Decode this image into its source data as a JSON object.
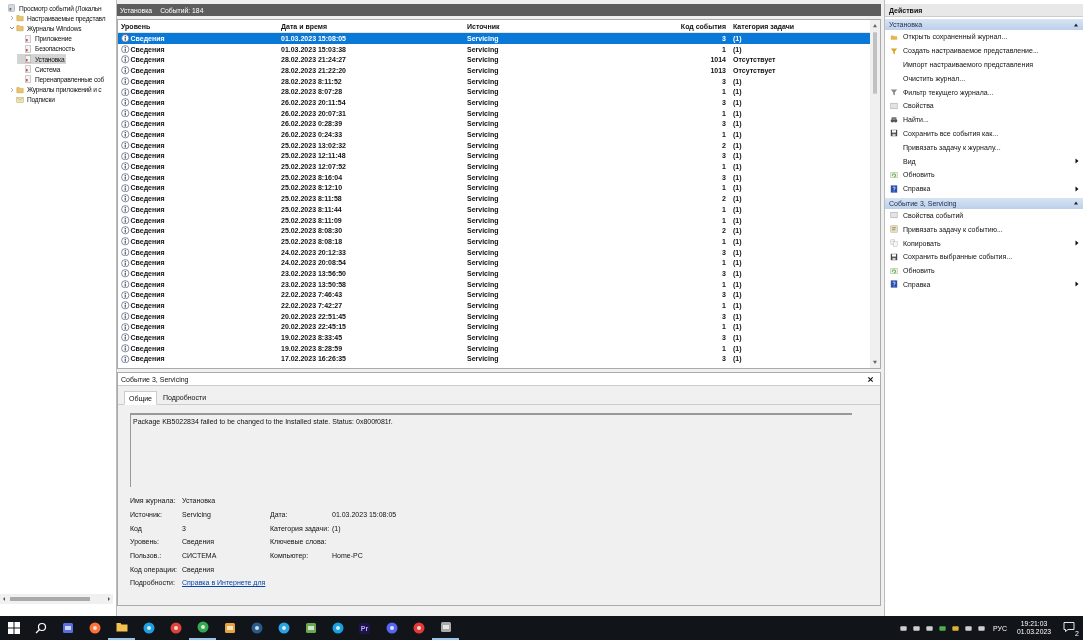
{
  "tree": [
    {
      "label": "Просмотр событий (Локальн",
      "kind": "viewer",
      "selected": false,
      "children": [
        {
          "label": "Настраиваемые представл",
          "kind": "folder",
          "selected": false,
          "expanded": false
        },
        {
          "label": "Журналы Windows",
          "kind": "folder",
          "selected": false,
          "expanded": true,
          "children": [
            {
              "label": "Приложение",
              "kind": "log",
              "selected": false
            },
            {
              "label": "Безопасность",
              "kind": "log",
              "selected": false
            },
            {
              "label": "Установка",
              "kind": "log",
              "selected": true
            },
            {
              "label": "Система",
              "kind": "log",
              "selected": false
            },
            {
              "label": "Перенаправленные соб",
              "kind": "log",
              "selected": false
            }
          ]
        },
        {
          "label": "Журналы приложений и с",
          "kind": "folder",
          "selected": false,
          "expanded": false
        },
        {
          "label": "Подписки",
          "kind": "subscriptions",
          "selected": false
        }
      ]
    }
  ],
  "log_header": {
    "name": "Установка",
    "count": "Событий: 184"
  },
  "table": {
    "columns": [
      "Уровень",
      "Дата и время",
      "Источник",
      "Код события",
      "Категория задачи"
    ],
    "rows": [
      {
        "level": "Сведения",
        "date": "01.03.2023 15:08:05",
        "source": "Servicing",
        "code": "3",
        "category": "(1)",
        "selected": true
      },
      {
        "level": "Сведения",
        "date": "01.03.2023 15:03:38",
        "source": "Servicing",
        "code": "1",
        "category": "(1)",
        "selected": false
      },
      {
        "level": "Сведения",
        "date": "28.02.2023 21:24:27",
        "source": "Servicing",
        "code": "1014",
        "category": "Отсутствует",
        "selected": false
      },
      {
        "level": "Сведения",
        "date": "28.02.2023 21:22:20",
        "source": "Servicing",
        "code": "1013",
        "category": "Отсутствует",
        "selected": false
      },
      {
        "level": "Сведения",
        "date": "28.02.2023 8:11:52",
        "source": "Servicing",
        "code": "3",
        "category": "(1)",
        "selected": false
      },
      {
        "level": "Сведения",
        "date": "28.02.2023 8:07:28",
        "source": "Servicing",
        "code": "1",
        "category": "(1)",
        "selected": false
      },
      {
        "level": "Сведения",
        "date": "26.02.2023 20:11:54",
        "source": "Servicing",
        "code": "3",
        "category": "(1)",
        "selected": false
      },
      {
        "level": "Сведения",
        "date": "26.02.2023 20:07:31",
        "source": "Servicing",
        "code": "1",
        "category": "(1)",
        "selected": false
      },
      {
        "level": "Сведения",
        "date": "26.02.2023 0:28:39",
        "source": "Servicing",
        "code": "3",
        "category": "(1)",
        "selected": false
      },
      {
        "level": "Сведения",
        "date": "26.02.2023 0:24:33",
        "source": "Servicing",
        "code": "1",
        "category": "(1)",
        "selected": false
      },
      {
        "level": "Сведения",
        "date": "25.02.2023 13:02:32",
        "source": "Servicing",
        "code": "2",
        "category": "(1)",
        "selected": false
      },
      {
        "level": "Сведения",
        "date": "25.02.2023 12:11:48",
        "source": "Servicing",
        "code": "3",
        "category": "(1)",
        "selected": false
      },
      {
        "level": "Сведения",
        "date": "25.02.2023 12:07:52",
        "source": "Servicing",
        "code": "1",
        "category": "(1)",
        "selected": false
      },
      {
        "level": "Сведения",
        "date": "25.02.2023 8:16:04",
        "source": "Servicing",
        "code": "3",
        "category": "(1)",
        "selected": false
      },
      {
        "level": "Сведения",
        "date": "25.02.2023 8:12:10",
        "source": "Servicing",
        "code": "1",
        "category": "(1)",
        "selected": false
      },
      {
        "level": "Сведения",
        "date": "25.02.2023 8:11:58",
        "source": "Servicing",
        "code": "2",
        "category": "(1)",
        "selected": false
      },
      {
        "level": "Сведения",
        "date": "25.02.2023 8:11:44",
        "source": "Servicing",
        "code": "1",
        "category": "(1)",
        "selected": false
      },
      {
        "level": "Сведения",
        "date": "25.02.2023 8:11:09",
        "source": "Servicing",
        "code": "1",
        "category": "(1)",
        "selected": false
      },
      {
        "level": "Сведения",
        "date": "25.02.2023 8:08:30",
        "source": "Servicing",
        "code": "2",
        "category": "(1)",
        "selected": false
      },
      {
        "level": "Сведения",
        "date": "25.02.2023 8:08:18",
        "source": "Servicing",
        "code": "1",
        "category": "(1)",
        "selected": false
      },
      {
        "level": "Сведения",
        "date": "24.02.2023 20:12:33",
        "source": "Servicing",
        "code": "3",
        "category": "(1)",
        "selected": false
      },
      {
        "level": "Сведения",
        "date": "24.02.2023 20:08:54",
        "source": "Servicing",
        "code": "1",
        "category": "(1)",
        "selected": false
      },
      {
        "level": "Сведения",
        "date": "23.02.2023 13:56:50",
        "source": "Servicing",
        "code": "3",
        "category": "(1)",
        "selected": false
      },
      {
        "level": "Сведения",
        "date": "23.02.2023 13:50:58",
        "source": "Servicing",
        "code": "1",
        "category": "(1)",
        "selected": false
      },
      {
        "level": "Сведения",
        "date": "22.02.2023 7:46:43",
        "source": "Servicing",
        "code": "3",
        "category": "(1)",
        "selected": false
      },
      {
        "level": "Сведения",
        "date": "22.02.2023 7:42:27",
        "source": "Servicing",
        "code": "1",
        "category": "(1)",
        "selected": false
      },
      {
        "level": "Сведения",
        "date": "20.02.2023 22:51:45",
        "source": "Servicing",
        "code": "3",
        "category": "(1)",
        "selected": false
      },
      {
        "level": "Сведения",
        "date": "20.02.2023 22:45:15",
        "source": "Servicing",
        "code": "1",
        "category": "(1)",
        "selected": false
      },
      {
        "level": "Сведения",
        "date": "19.02.2023 8:33:45",
        "source": "Servicing",
        "code": "3",
        "category": "(1)",
        "selected": false
      },
      {
        "level": "Сведения",
        "date": "19.02.2023 8:28:59",
        "source": "Servicing",
        "code": "1",
        "category": "(1)",
        "selected": false
      },
      {
        "level": "Сведения",
        "date": "17.02.2023 16:26:35",
        "source": "Servicing",
        "code": "3",
        "category": "(1)",
        "selected": false
      }
    ]
  },
  "details": {
    "title": "Событие 3, Servicing",
    "tabs": [
      {
        "label": "Общие",
        "selected": true
      },
      {
        "label": "Подробности",
        "selected": false
      }
    ],
    "message": "Package KB5022834 failed to be changed to the Installed state. Status: 0x800f081f.",
    "rows": [
      {
        "left": {
          "label": "Имя журнала:",
          "value": "Установка"
        }
      },
      {
        "left": {
          "label": "Источник:",
          "value": "Servicing"
        },
        "right": {
          "label": "Дата:",
          "value": "01.03.2023 15:08:05"
        }
      },
      {
        "left": {
          "label": "Код",
          "value": "3"
        },
        "right": {
          "label": "Категория задачи:",
          "value": "(1)"
        }
      },
      {
        "left": {
          "label": "Уровень:",
          "value": "Сведения"
        },
        "right": {
          "label": "Ключевые слова:"
        }
      },
      {
        "left": {
          "label": "Пользов.:",
          "value": "СИСТЕМА"
        },
        "right": {
          "label": "Компьютер:",
          "value": "Home-PC"
        }
      },
      {
        "left": {
          "label": "Код операции:",
          "value": "Сведения"
        }
      },
      {
        "left": {
          "label": "Подробности:",
          "value": "Справка в Интернете для",
          "kind": "link"
        }
      }
    ]
  },
  "actions": {
    "title": "Действия",
    "sections": [
      {
        "title": "Установка",
        "expanded": true,
        "items": [
          {
            "label": "Открыть сохраненный журнал...",
            "kind": "open",
            "submenu": false
          },
          {
            "label": "Создать настраиваемое представление...",
            "kind": "filter",
            "submenu": false
          },
          {
            "label": "Импорт настраиваемого представления",
            "kind": "none",
            "submenu": false
          },
          {
            "label": "Очистить журнал...",
            "kind": "none",
            "submenu": false
          },
          {
            "label": "Фильтр текущего журнала...",
            "kind": "filter-gray",
            "submenu": false
          },
          {
            "label": "Свойства",
            "kind": "properties",
            "submenu": false
          },
          {
            "label": "Найти...",
            "kind": "find",
            "submenu": false
          },
          {
            "label": "Сохранить все события как...",
            "kind": "save",
            "submenu": false
          },
          {
            "label": "Привязать задачу к журналу...",
            "kind": "none",
            "submenu": false
          },
          {
            "label": "Вид",
            "kind": "none",
            "submenu": true
          },
          {
            "label": "Обновить",
            "kind": "refresh",
            "submenu": false
          },
          {
            "label": "Справка",
            "kind": "help",
            "submenu": true
          }
        ]
      },
      {
        "title": "Событие 3, Servicing",
        "expanded": true,
        "items": [
          {
            "label": "Свойства событий",
            "kind": "properties",
            "submenu": false
          },
          {
            "label": "Привязать задачу к событию...",
            "kind": "task",
            "submenu": false
          },
          {
            "label": "Копировать",
            "kind": "copy",
            "submenu": true
          },
          {
            "label": "Сохранить выбранные события...",
            "kind": "save",
            "submenu": false
          },
          {
            "label": "Обновить",
            "kind": "refresh",
            "submenu": false
          },
          {
            "label": "Справка",
            "kind": "help",
            "submenu": true
          }
        ]
      }
    ]
  },
  "taskbar": {
    "apps": [
      {
        "kind": "start"
      },
      {
        "kind": "search"
      },
      {
        "kind": "mail"
      },
      {
        "kind": "browser-orange"
      },
      {
        "kind": "folder",
        "running": true
      },
      {
        "kind": "globe"
      },
      {
        "kind": "vpn"
      },
      {
        "kind": "chrome",
        "running": true
      },
      {
        "kind": "gear"
      },
      {
        "kind": "steam"
      },
      {
        "kind": "telegram"
      },
      {
        "kind": "editor"
      },
      {
        "kind": "skype"
      },
      {
        "kind": "premiere",
        "label": "Pr"
      },
      {
        "kind": "discord"
      },
      {
        "kind": "stop"
      },
      {
        "kind": "viewer",
        "running": true
      }
    ],
    "language": "РУС",
    "time": "19:21:03",
    "date": "01.03.2023",
    "notifications": "2"
  }
}
